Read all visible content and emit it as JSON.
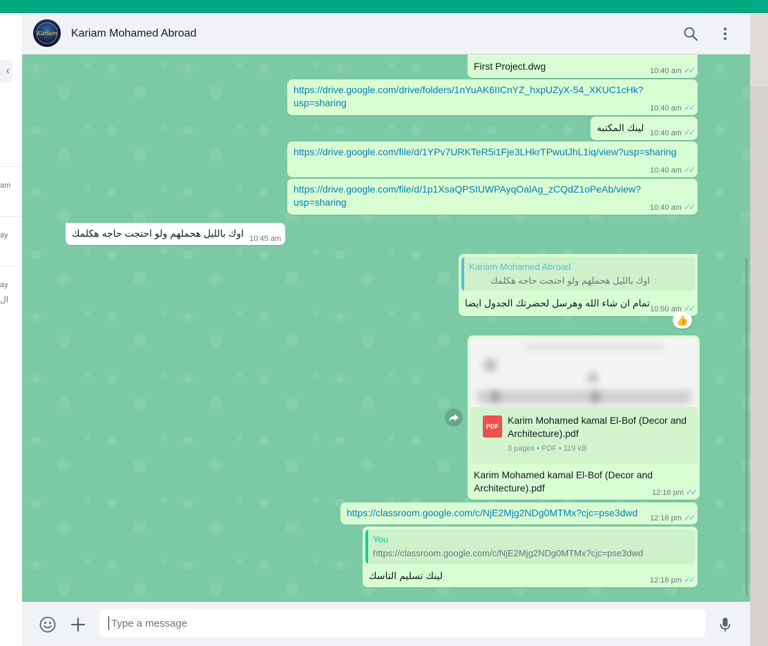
{
  "sidebar": {
    "back_glyph": "‹",
    "labels": [
      "am",
      "ay",
      "ay",
      "ال"
    ]
  },
  "header": {
    "contact_name": "Kariam Mohamed Abroad",
    "avatar_text": "Kariam",
    "icons": [
      "search-icon",
      "menu-icon"
    ]
  },
  "messages": {
    "m1": {
      "text": "First Project.dwg",
      "time": "10:40 am"
    },
    "m2": {
      "line1": "https://drive.google.com/drive/folders/1nYuAK6IICnYZ_hxpUZyX-54_XKUC1cHk?",
      "line2": "usp=sharing",
      "time": "10:40 am"
    },
    "m3": {
      "text": "لينك المكتبه",
      "time": "10:40 am"
    },
    "m4": {
      "text": "https://drive.google.com/file/d/1YPv7URKTeR5i1Fje3LHkrTPwutJhL1iq/view?usp=sharing",
      "time": "10:40 am"
    },
    "m5": {
      "line1": "https://drive.google.com/file/d/1p1XsaQPSIUWPAyqOalAg_zCQdZ1oPeAb/view?",
      "line2": "usp=sharing",
      "time": "10:40 am"
    },
    "m6": {
      "text": "اوك بالليل هحملهم ولو احتجت حاجه هكلمك",
      "time": "10:45 am"
    },
    "m7": {
      "quote_name": "Kariam Mohamed Abroad",
      "quote_text": "اوك بالليل هحملهم ولو احتجت حاجه هكلمك",
      "text": "تمام ان شاء الله وهرسل لحضرتك الجدول ايضا",
      "time": "10:50 am",
      "reaction": "👍"
    },
    "m8": {
      "file_title": "Karim Mohamed kamal El-Bof (Decor and Architecture).pdf",
      "file_icon": "PDF",
      "file_meta": "3 pages • PDF • 119 kB",
      "caption": "Karim Mohamed kamal El-Bof (Decor and Architecture).pdf",
      "time": "12:16 pm",
      "forward_icon": "forward-icon"
    },
    "m9": {
      "text": "https://classroom.google.com/c/NjE2Mjg2NDg0MTMx?cjc=pse3dwd",
      "time": "12:16 pm"
    },
    "m10": {
      "quote_name": "You",
      "quote_text": "https://classroom.google.com/c/NjE2Mjg2NDg0MTMx?cjc=pse3dwd",
      "text": "لينك تسليم التاسك",
      "time": "12:16 pm"
    },
    "ticks": "✓✓"
  },
  "composer": {
    "placeholder": "Type a message",
    "icons": [
      "emoji-icon",
      "attach-plus-icon",
      "microphone-icon"
    ]
  },
  "colors": {
    "accent": "#00a884",
    "outgoing_bubble": "#d9fdd3",
    "incoming_bubble": "#ffffff",
    "chat_background": "#7cc9a5",
    "link": "#027eb5",
    "read_ticks": "#53bdeb"
  }
}
